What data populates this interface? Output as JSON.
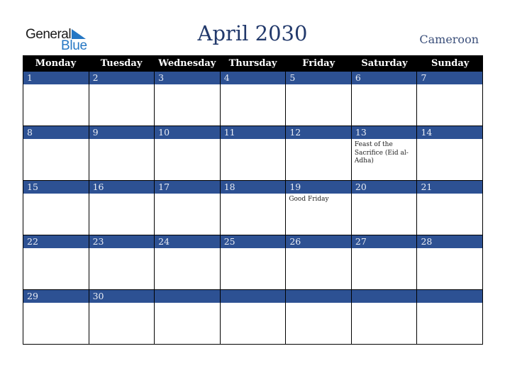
{
  "logo": {
    "word1": "General",
    "word2": "Blue"
  },
  "header": {
    "title": "April 2030",
    "country": "Cameroon"
  },
  "colors": {
    "band": "#2d5193",
    "header_bg": "#000000",
    "title": "#22396b",
    "logo_blue": "#2577c4"
  },
  "weekdays": [
    "Monday",
    "Tuesday",
    "Wednesday",
    "Thursday",
    "Friday",
    "Saturday",
    "Sunday"
  ],
  "weeks": [
    [
      {
        "day": "1",
        "event": ""
      },
      {
        "day": "2",
        "event": ""
      },
      {
        "day": "3",
        "event": ""
      },
      {
        "day": "4",
        "event": ""
      },
      {
        "day": "5",
        "event": ""
      },
      {
        "day": "6",
        "event": ""
      },
      {
        "day": "7",
        "event": ""
      }
    ],
    [
      {
        "day": "8",
        "event": ""
      },
      {
        "day": "9",
        "event": ""
      },
      {
        "day": "10",
        "event": ""
      },
      {
        "day": "11",
        "event": ""
      },
      {
        "day": "12",
        "event": ""
      },
      {
        "day": "13",
        "event": "Feast of the Sacrifice (Eid al-Adha)"
      },
      {
        "day": "14",
        "event": ""
      }
    ],
    [
      {
        "day": "15",
        "event": ""
      },
      {
        "day": "16",
        "event": ""
      },
      {
        "day": "17",
        "event": ""
      },
      {
        "day": "18",
        "event": ""
      },
      {
        "day": "19",
        "event": "Good Friday"
      },
      {
        "day": "20",
        "event": ""
      },
      {
        "day": "21",
        "event": ""
      }
    ],
    [
      {
        "day": "22",
        "event": ""
      },
      {
        "day": "23",
        "event": ""
      },
      {
        "day": "24",
        "event": ""
      },
      {
        "day": "25",
        "event": ""
      },
      {
        "day": "26",
        "event": ""
      },
      {
        "day": "27",
        "event": ""
      },
      {
        "day": "28",
        "event": ""
      }
    ],
    [
      {
        "day": "29",
        "event": ""
      },
      {
        "day": "30",
        "event": ""
      },
      {
        "day": "",
        "event": ""
      },
      {
        "day": "",
        "event": ""
      },
      {
        "day": "",
        "event": ""
      },
      {
        "day": "",
        "event": ""
      },
      {
        "day": "",
        "event": ""
      }
    ]
  ]
}
